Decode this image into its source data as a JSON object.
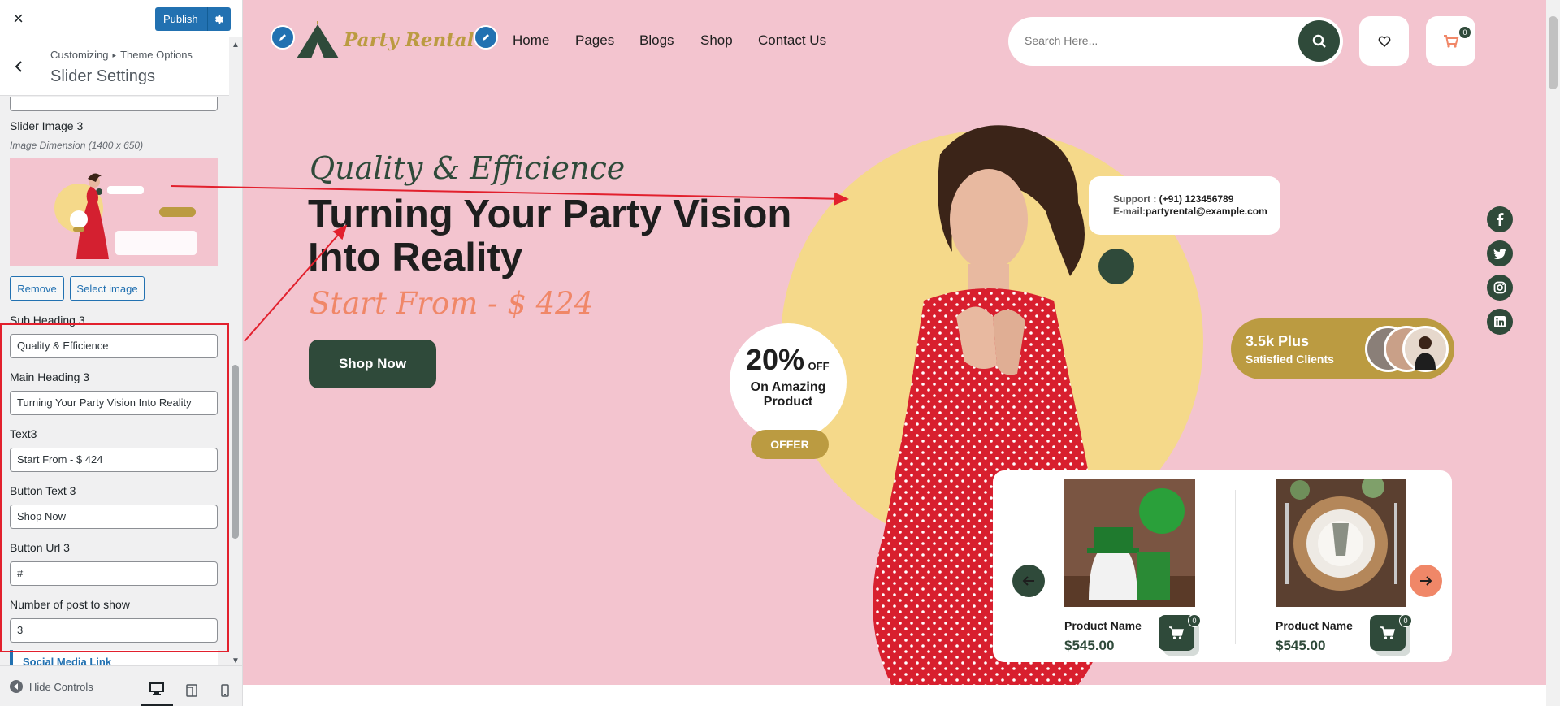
{
  "customizer": {
    "close_label": "×",
    "publish_label": "Publish",
    "breadcrumb": {
      "root": "Customizing",
      "arrow": "▸",
      "parent": "Theme Options"
    },
    "section_title": "Slider Settings",
    "slider_image": {
      "label": "Slider Image 3",
      "description": "Image Dimension (1400 x 650)",
      "remove_label": "Remove",
      "select_label": "Select image"
    },
    "fields": {
      "subheading": {
        "label": "Sub Heading 3",
        "value": "Quality & Efficience"
      },
      "mainheading": {
        "label": "Main Heading 3",
        "value": "Turning Your Party Vision Into Reality"
      },
      "text": {
        "label": "Text3",
        "value": "Start From - $ 424"
      },
      "button_text": {
        "label": "Button Text 3",
        "value": "Shop Now"
      },
      "button_url": {
        "label": "Button Url 3",
        "value": "#"
      },
      "num_posts": {
        "label": "Number of post to show",
        "value": "3"
      }
    },
    "next_section_label": "Social Media Link",
    "footer": {
      "hide_controls_label": "Hide Controls"
    }
  },
  "site": {
    "logo_text": "Party Rental",
    "nav": [
      "Home",
      "Pages",
      "Blogs",
      "Shop",
      "Contact Us"
    ],
    "search_placeholder": "Search Here...",
    "cart_count": "0",
    "hero": {
      "subheading": "Quality & Efficience",
      "heading": "Turning Your Party Vision Into Reality",
      "price_text": "Start From - $ 424",
      "button_label": "Shop Now"
    },
    "support": {
      "label": "Support : ",
      "phone": "(+91) 123456789",
      "email_label": "E-mail:",
      "email": "partyrental@example.com"
    },
    "offer": {
      "percent": "20%",
      "off": "OFF",
      "line": "On Amazing Product",
      "button": "OFFER"
    },
    "clients": {
      "count": "3.5k Plus",
      "label": "Satisfied Clients"
    },
    "products": [
      {
        "name": "Product Name",
        "price": "$545.00",
        "cart_count": "0"
      },
      {
        "name": "Product Name",
        "price": "$545.00",
        "cart_count": "0"
      }
    ]
  },
  "colors": {
    "accent_blue": "#2271b1",
    "dark_green": "#2f4a3a",
    "preview_bg": "#f3c4cf",
    "gold": "#bb9b41",
    "coral": "#f08768",
    "annotation_red": "#e2202d"
  }
}
